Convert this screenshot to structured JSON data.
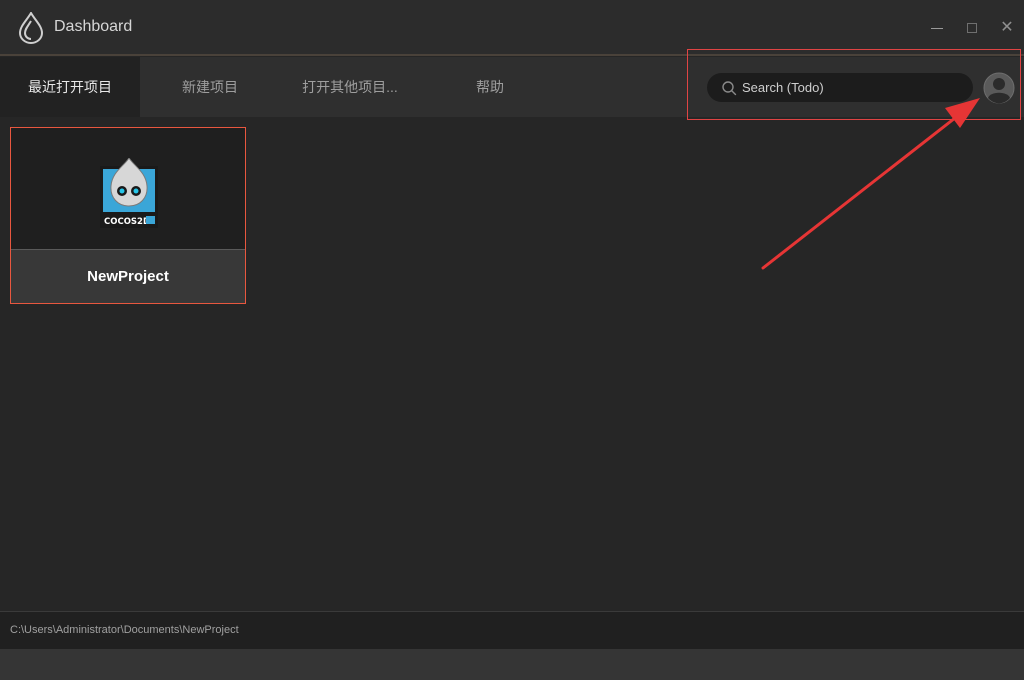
{
  "window": {
    "title": "Dashboard",
    "logo_icon": "cocos-creator-logo-icon",
    "minimize_icon": "minimize-icon",
    "maximize_icon": "maximize-icon",
    "close_symbol": "✕"
  },
  "tabs": [
    {
      "label": "最近打开项目",
      "active": true
    },
    {
      "label": "新建项目",
      "active": false
    },
    {
      "label": "打开其他项目...",
      "active": false
    },
    {
      "label": "帮助",
      "active": false
    }
  ],
  "search": {
    "placeholder": "Search (Todo)",
    "value": "",
    "icon": "search-icon"
  },
  "user": {
    "avatar_icon": "user-avatar-icon"
  },
  "projects": [
    {
      "name": "NewProject",
      "thumbnail_icon": "cocos2d-logo-icon",
      "thumbnail_text": "COCOS2D"
    }
  ],
  "status": {
    "path": "C:\\Users\\Administrator\\Documents\\NewProject"
  },
  "colors": {
    "background": "#262626",
    "accent_border": "#e8573f",
    "annotation_red": "#e04444"
  }
}
